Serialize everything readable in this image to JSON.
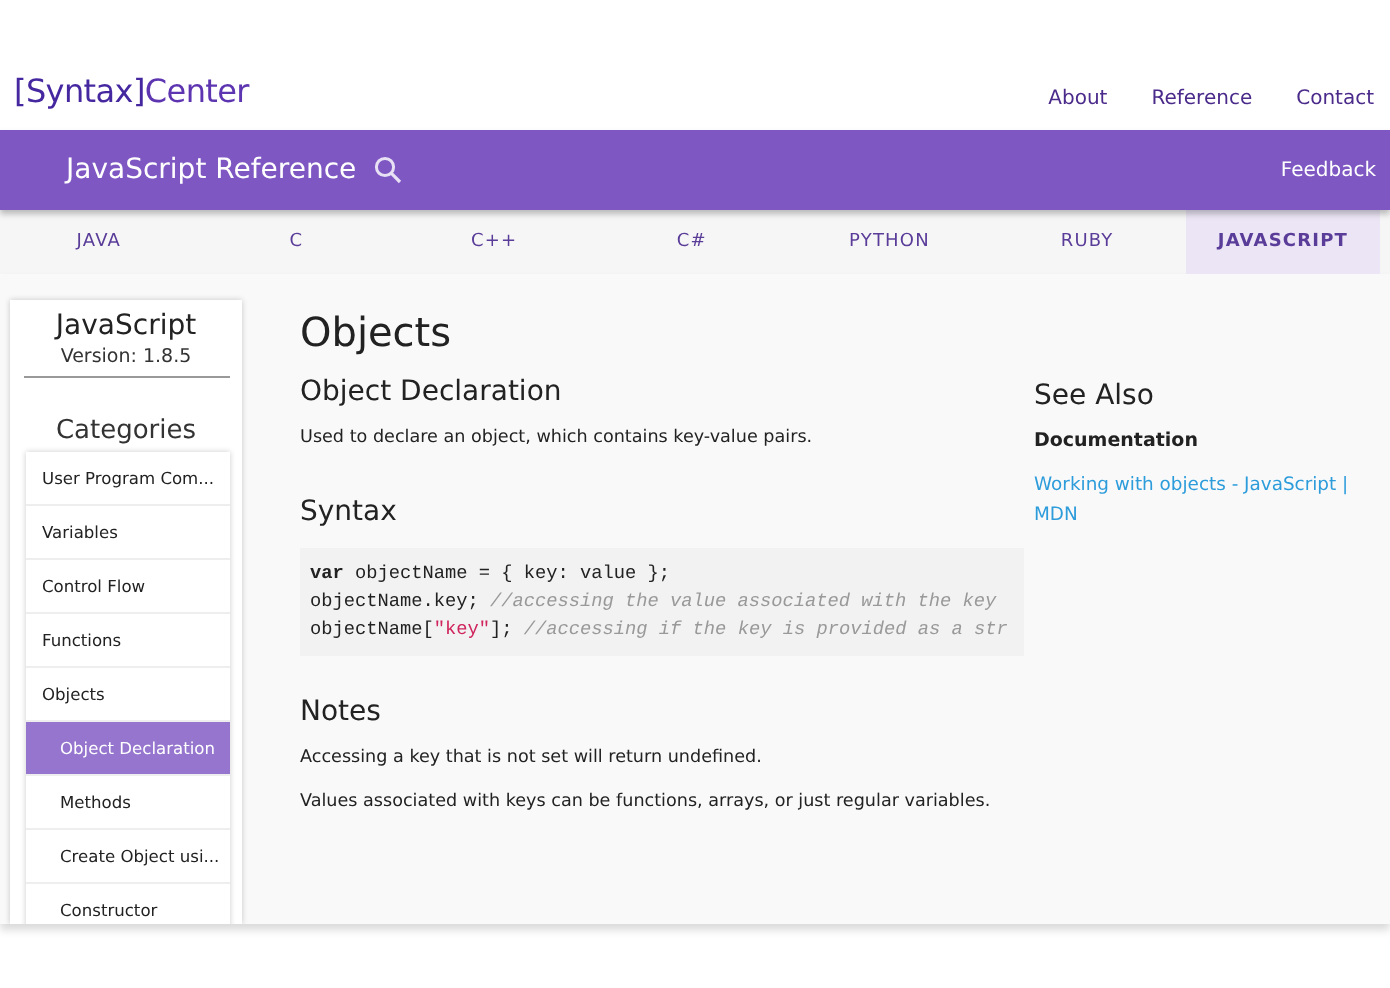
{
  "site": {
    "logo_bracket": "[Syntax]",
    "logo_name": "Center",
    "nav": [
      "About",
      "Reference",
      "Contact"
    ]
  },
  "banner": {
    "title": "JavaScript Reference",
    "feedback": "Feedback"
  },
  "tabs": [
    {
      "label": "JAVA",
      "selected": false
    },
    {
      "label": "C",
      "selected": false
    },
    {
      "label": "C++",
      "selected": false
    },
    {
      "label": "C#",
      "selected": false
    },
    {
      "label": "PYTHON",
      "selected": false
    },
    {
      "label": "RUBY",
      "selected": false
    },
    {
      "label": "JAVASCRIPT",
      "selected": true
    }
  ],
  "sidebar": {
    "language": "JavaScript",
    "version": "Version: 1.8.5",
    "heading": "Categories",
    "items": [
      {
        "label": "User Program Com...",
        "selected": false
      },
      {
        "label": "Variables",
        "selected": false
      },
      {
        "label": "Control Flow",
        "selected": false
      },
      {
        "label": "Functions",
        "selected": false
      },
      {
        "label": "Objects",
        "selected": false,
        "children": [
          {
            "label": "Object Declaration",
            "selected": true
          },
          {
            "label": "Methods",
            "selected": false
          },
          {
            "label": "Create Object usi...",
            "selected": false
          },
          {
            "label": "Constructor",
            "selected": false
          }
        ]
      }
    ]
  },
  "main": {
    "title": "Objects",
    "section": "Object Declaration",
    "description": "Used to declare an object, which contains key-value pairs.",
    "syntax_heading": "Syntax",
    "code": [
      [
        {
          "kind": "keyword",
          "text": "var"
        },
        {
          "kind": "plain",
          "text": " objectName = { key: value };"
        }
      ],
      [
        {
          "kind": "plain",
          "text": "objectName.key; "
        },
        {
          "kind": "comment",
          "text": "//accessing the value associated with the key"
        }
      ],
      [
        {
          "kind": "plain",
          "text": "objectName["
        },
        {
          "kind": "string",
          "text": "\"key\""
        },
        {
          "kind": "plain",
          "text": "]; "
        },
        {
          "kind": "comment",
          "text": "//accessing if the key is provided as a str"
        }
      ]
    ],
    "notes_heading": "Notes",
    "notes": [
      "Accessing a key that is not set will return undefined.",
      "Values associated with keys can be functions, arrays, or just regular variables."
    ]
  },
  "see_also": {
    "heading": "See Also",
    "subheading": "Documentation",
    "link": "Working with objects - JavaScript | MDN"
  }
}
